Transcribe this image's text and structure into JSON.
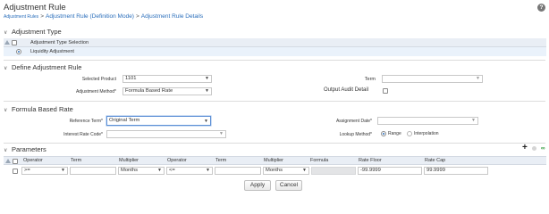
{
  "page": {
    "title": "Adjustment Rule",
    "help_icon_glyph": "?",
    "breadcrumbs": [
      "Adjustment Rules",
      "Adjustment Rule (Definition Mode)",
      "Adjustment Rule Details"
    ],
    "separator": ">"
  },
  "adjustment_type": {
    "heading": "Adjustment Type",
    "column_header": "Adjustment Type Selection",
    "rows": [
      "Liquidity Adjustment"
    ]
  },
  "define_rule": {
    "heading": "Define Adjustment Rule",
    "selected_product_label": "Selected Product",
    "selected_product_value": "1101",
    "term_label": "Term",
    "term_value": "",
    "adjustment_method_label": "Adjustment Method*",
    "adjustment_method_value": "Formula Based Rate",
    "output_audit_label": "Output Audit Detail"
  },
  "formula": {
    "heading": "Formula Based Rate",
    "reference_term_label": "Reference Term*",
    "reference_term_value": "Original Term",
    "assignment_date_label": "Assignment Date*",
    "assignment_date_value": "",
    "interest_rate_code_label": "Interest Rate Code*",
    "interest_rate_code_value": "",
    "lookup_method_label": "Lookup Method*",
    "lookup_options": [
      "Range",
      "Interpolation"
    ],
    "lookup_selected": "Range"
  },
  "parameters": {
    "heading": "Parameters",
    "columns": [
      "Operator",
      "Term",
      "Multiplier",
      "Operator",
      "Term",
      "Multiplier",
      "Formula",
      "Rate Floor",
      "Rate Cap"
    ],
    "row": {
      "operator1": ">=",
      "term1": "",
      "multiplier1": "Months",
      "operator2": "<=",
      "term2": "",
      "multiplier2": "Months",
      "formula": "",
      "rate_floor": "-99.9999",
      "rate_cap": "99.9999"
    }
  },
  "actions": {
    "apply": "Apply",
    "cancel": "Cancel"
  },
  "icons": {
    "chevron": "∨",
    "dropdown": "▼",
    "plus": "+",
    "link": "∞"
  },
  "colors": {
    "link": "#2a6ebb",
    "header_bg": "#e9eef5",
    "selected_row_bg": "#eaf2fb",
    "add_link_icon": "#2e9a3a"
  }
}
